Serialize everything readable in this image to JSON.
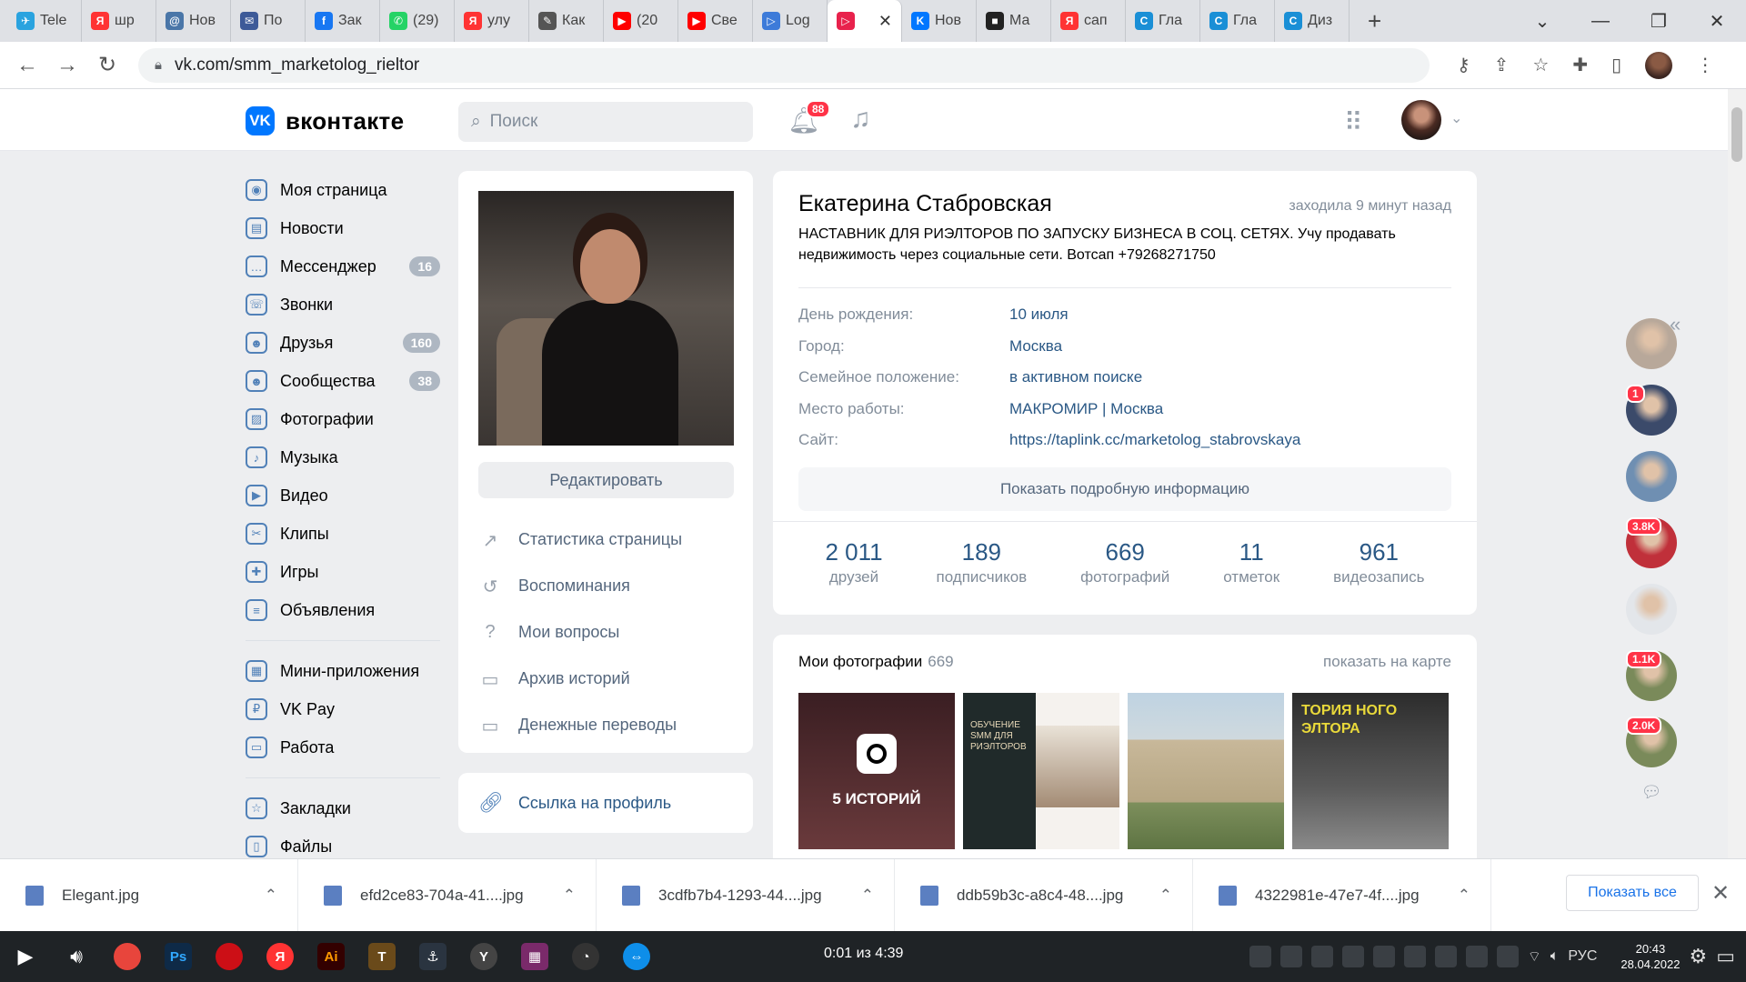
{
  "browser": {
    "tabs": [
      {
        "label": "Tele",
        "color": "#2aa3df",
        "glyph": "✈"
      },
      {
        "label": "шр",
        "color": "#ff3333",
        "glyph": "Я"
      },
      {
        "label": "Нов",
        "color": "#4a76a8",
        "glyph": "@"
      },
      {
        "label": "По",
        "color": "#3d5a98",
        "glyph": "✉"
      },
      {
        "label": "Зак",
        "color": "#1877f2",
        "glyph": "f"
      },
      {
        "label": "(29)",
        "color": "#25d366",
        "glyph": "✆"
      },
      {
        "label": "улу",
        "color": "#ff3333",
        "glyph": "Я"
      },
      {
        "label": "Как",
        "color": "#555555",
        "glyph": "✎"
      },
      {
        "label": "(20",
        "color": "#ff0000",
        "glyph": "▶"
      },
      {
        "label": "Све",
        "color": "#ff0000",
        "glyph": "▶"
      },
      {
        "label": "Log",
        "color": "#3d7bd9",
        "glyph": "▷"
      },
      {
        "label": "",
        "color": "#e8224c",
        "glyph": "▷",
        "active": true
      },
      {
        "label": "Нов",
        "color": "#0077ff",
        "glyph": "K"
      },
      {
        "label": "Ма",
        "color": "#222222",
        "glyph": "■"
      },
      {
        "label": "сап",
        "color": "#ff3333",
        "glyph": "Я"
      },
      {
        "label": "Гла",
        "color": "#1a8fd6",
        "glyph": "C"
      },
      {
        "label": "Гла",
        "color": "#1a8fd6",
        "glyph": "C"
      },
      {
        "label": "Диз",
        "color": "#1a8fd6",
        "glyph": "C"
      }
    ],
    "url": "vk.com/smm_marketolog_rieltor"
  },
  "vk": {
    "logo_text": "вконтакте",
    "search_placeholder": "Поиск",
    "notifications_count": "88"
  },
  "leftnav": [
    {
      "label": "Моя страница",
      "icon": "user-circle-icon",
      "glyph": "◉"
    },
    {
      "label": "Новости",
      "icon": "news-icon",
      "glyph": "▤"
    },
    {
      "label": "Мессенджер",
      "icon": "chat-icon",
      "glyph": "…",
      "count": "16"
    },
    {
      "label": "Звонки",
      "icon": "phone-icon",
      "glyph": "☏"
    },
    {
      "label": "Друзья",
      "icon": "friends-icon",
      "glyph": "☻",
      "count": "160"
    },
    {
      "label": "Сообщества",
      "icon": "communities-icon",
      "glyph": "☻",
      "count": "38"
    },
    {
      "label": "Фотографии",
      "icon": "photos-icon",
      "glyph": "▨"
    },
    {
      "label": "Музыка",
      "icon": "music-icon",
      "glyph": "♪"
    },
    {
      "label": "Видео",
      "icon": "video-icon",
      "glyph": "▶"
    },
    {
      "label": "Клипы",
      "icon": "clips-icon",
      "glyph": "✂"
    },
    {
      "label": "Игры",
      "icon": "games-icon",
      "glyph": "✚"
    },
    {
      "label": "Объявления",
      "icon": "classifieds-icon",
      "glyph": "≡"
    }
  ],
  "leftnav2": [
    {
      "label": "Мини-приложения",
      "icon": "apps-grid-icon",
      "glyph": "▦"
    },
    {
      "label": "VK Pay",
      "icon": "vkpay-icon",
      "glyph": "₽"
    },
    {
      "label": "Работа",
      "icon": "briefcase-icon",
      "glyph": "▭"
    }
  ],
  "leftnav3": [
    {
      "label": "Закладки",
      "icon": "star-icon",
      "glyph": "☆"
    },
    {
      "label": "Файлы",
      "icon": "file-icon",
      "glyph": "▯"
    }
  ],
  "profile": {
    "edit_label": "Редактировать",
    "menu": [
      {
        "label": "Статистика страницы",
        "icon": "stats-icon",
        "glyph": "↗"
      },
      {
        "label": "Воспоминания",
        "icon": "memories-icon",
        "glyph": "↺"
      },
      {
        "label": "Мои вопросы",
        "icon": "question-icon",
        "glyph": "?"
      },
      {
        "label": "Архив историй",
        "icon": "archive-icon",
        "glyph": "▭"
      },
      {
        "label": "Денежные переводы",
        "icon": "money-transfer-icon",
        "glyph": "▭"
      }
    ],
    "link_label": "Ссылка на профиль",
    "name": "Екатерина Стабровская",
    "last_seen": "заходила 9 минут назад",
    "status": "НАСТАВНИК ДЛЯ РИЭЛТОРОВ ПО ЗАПУСКУ БИЗНЕСА В СОЦ. СЕТЯХ. Учу продавать недвижимость через социальные сети. Вотсап +79268271750",
    "info": [
      {
        "label": "День рождения:",
        "value": "10 июля"
      },
      {
        "label": "Город:",
        "value": "Москва"
      },
      {
        "label": "Семейное положение:",
        "value": "в активном поиске"
      },
      {
        "label": "Место работы:",
        "value": "МАКРОМИР | Москва"
      },
      {
        "label": "Сайт:",
        "value": "https://taplink.cc/marketolog_stabrovskaya"
      }
    ],
    "more_info_label": "Показать подробную информацию",
    "counters": [
      {
        "num": "2 011",
        "label": "друзей"
      },
      {
        "num": "189",
        "label": "подписчиков"
      },
      {
        "num": "669",
        "label": "фотографий"
      },
      {
        "num": "11",
        "label": "отметок"
      },
      {
        "num": "961",
        "label": "видеозапись"
      }
    ],
    "photos_title": "Мои фотографии",
    "photos_count": "669",
    "show_on_map": "показать на карте",
    "stories_label": "5 ИСТОРИЙ",
    "collage_text": "ОБУЧЕНИЕ SMM ДЛЯ РИЭЛТОРОВ",
    "hall_text": "ТОРИЯ НОГО ЭЛТОРА"
  },
  "rail": [
    {
      "badge": "",
      "color": "#b8a89a"
    },
    {
      "badge": "1",
      "color": "#3b4a6a"
    },
    {
      "badge": "",
      "color": "#6f8fb2"
    },
    {
      "badge": "3.8K",
      "color": "#c0303a"
    },
    {
      "badge": "",
      "color": "#e3e6ea"
    },
    {
      "badge": "1.1K",
      "color": "#7a8a5a"
    },
    {
      "badge": "2.0K",
      "color": "#7a8a5a"
    }
  ],
  "downloads": [
    {
      "name": "Elegant.jpg"
    },
    {
      "name": "efd2ce83-704a-41....jpg"
    },
    {
      "name": "3cdfb7b4-1293-44....jpg"
    },
    {
      "name": "ddb59b3c-a8c4-48....jpg"
    },
    {
      "name": "4322981e-47e7-4f....jpg"
    }
  ],
  "show_all_label": "Показать все",
  "taskbar": {
    "player_time": "0:01 из 4:39",
    "lang": "РУС",
    "time": "20:43",
    "date": "28.04.2022"
  }
}
